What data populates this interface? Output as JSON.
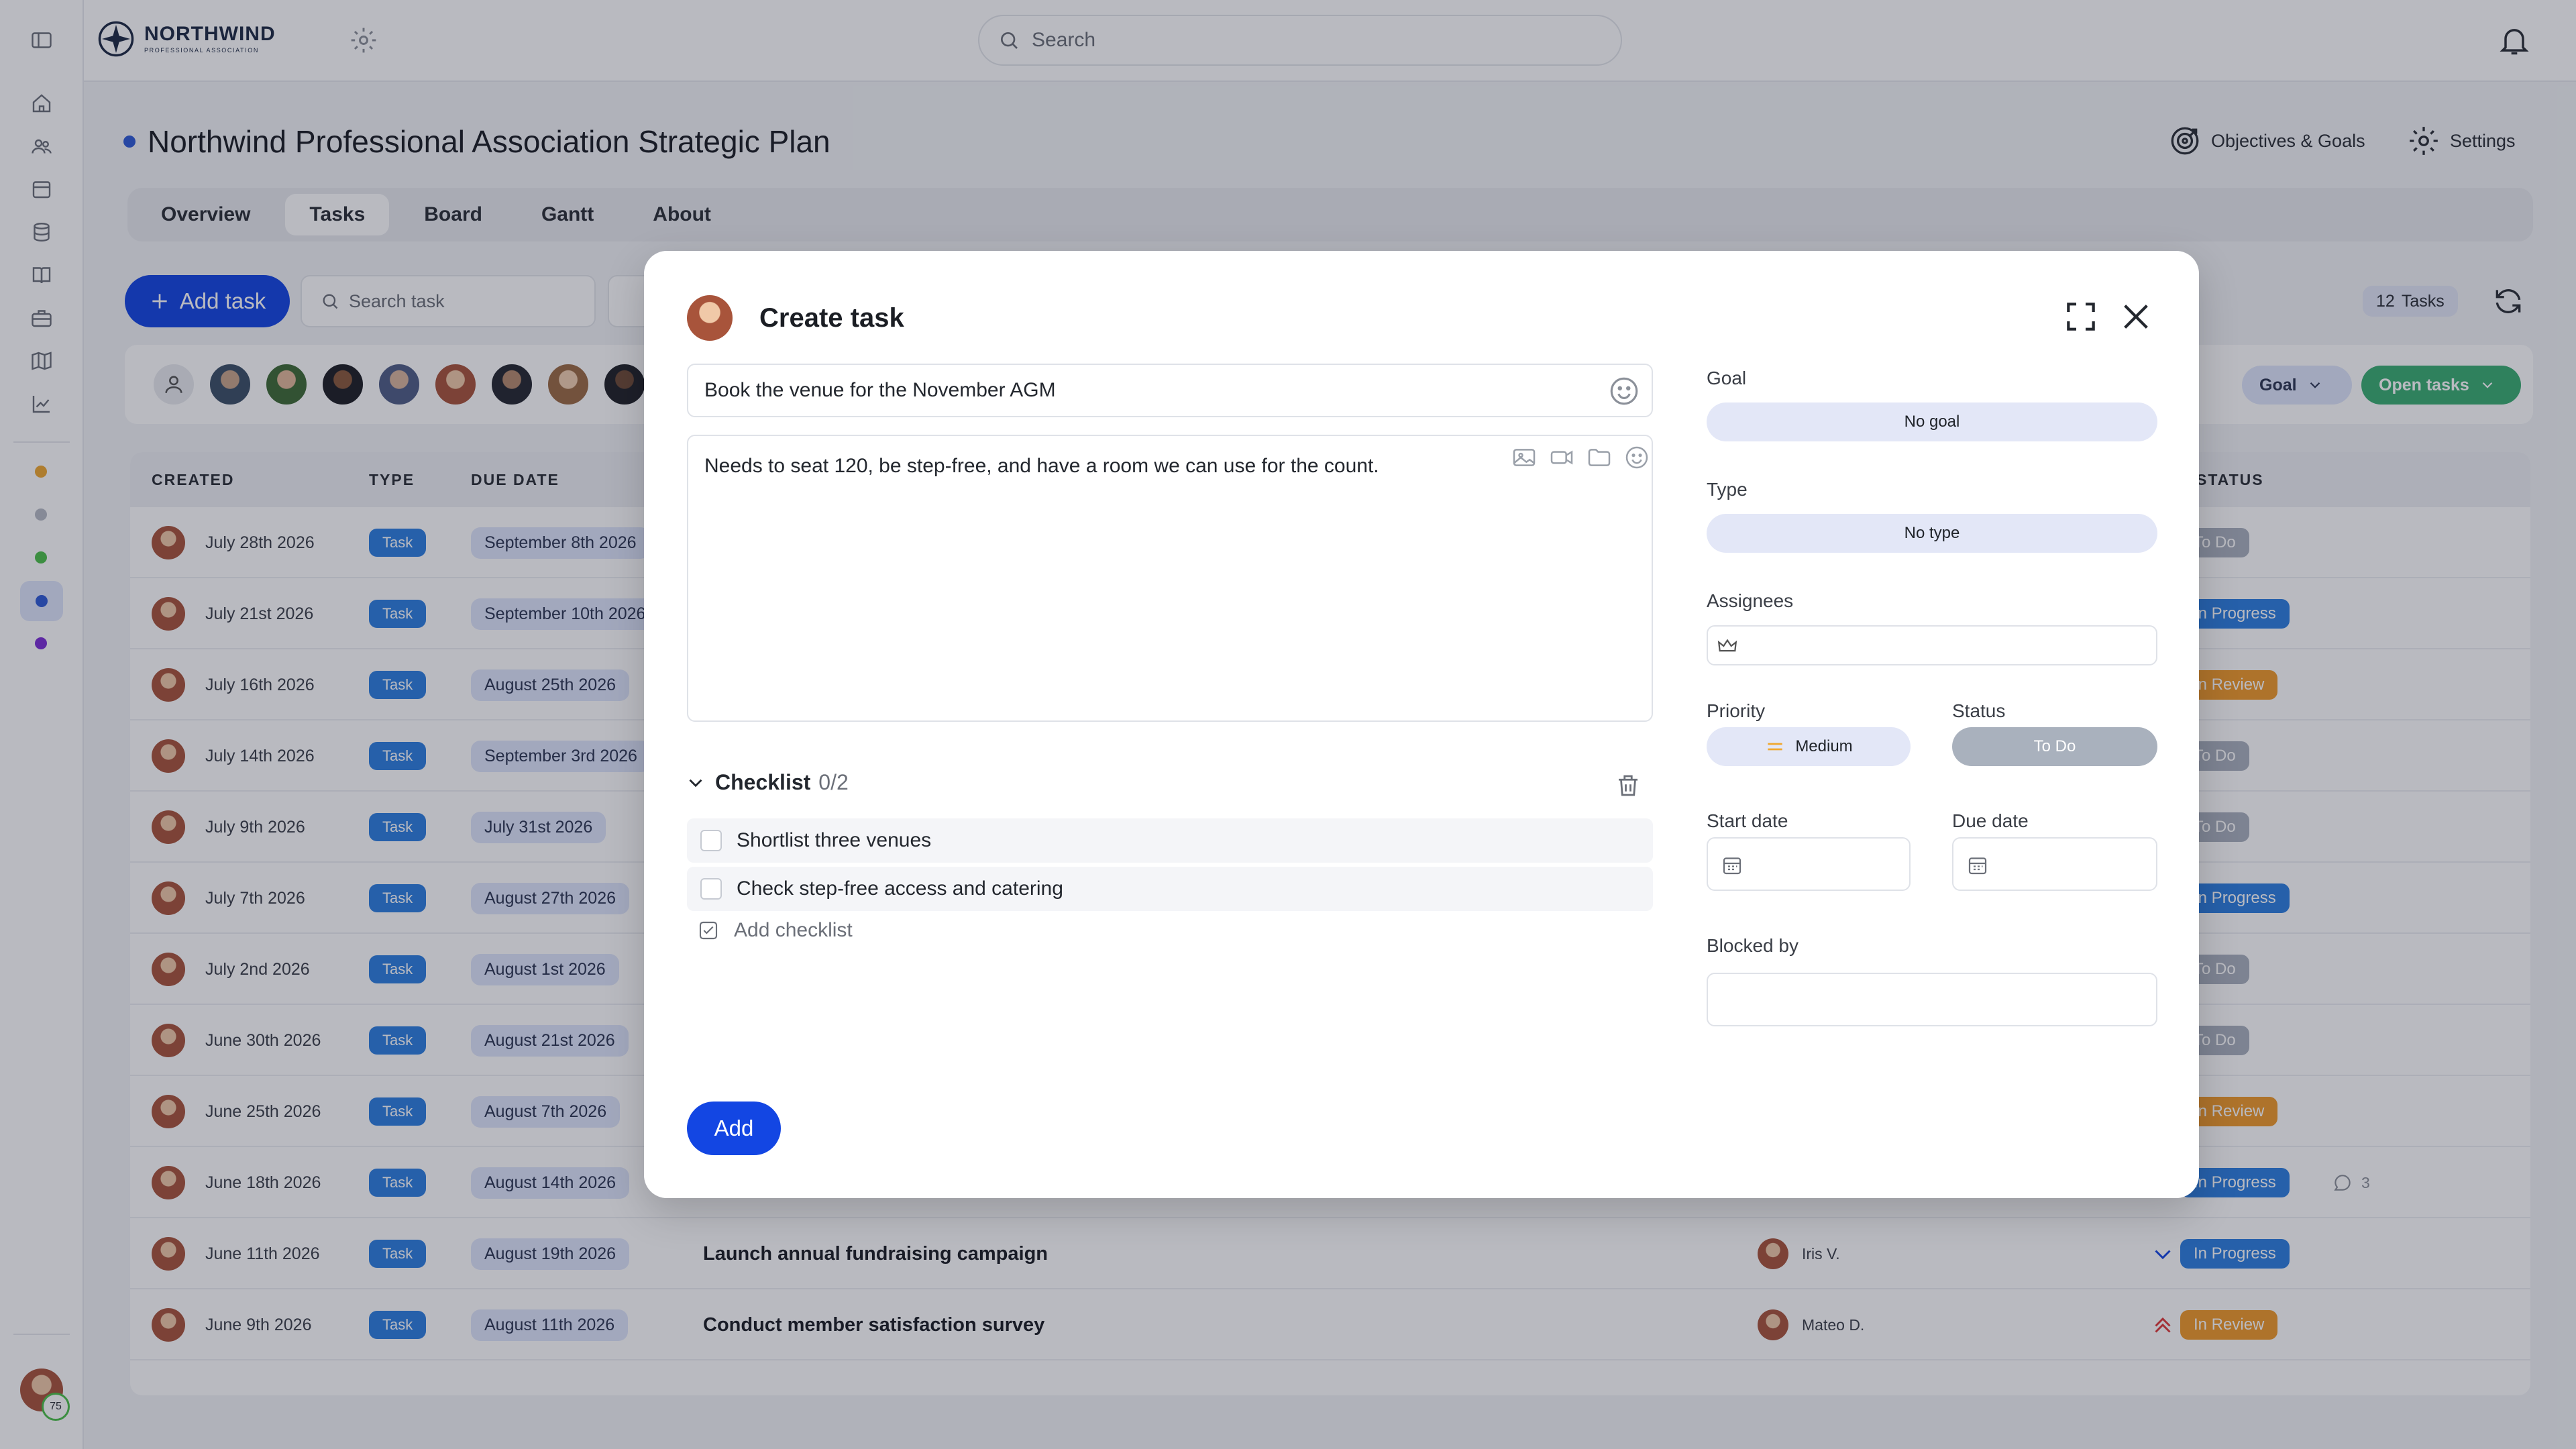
{
  "topbar": {
    "logo_name": "NORTHWIND",
    "logo_sub": "PROFESSIONAL ASSOCIATION",
    "search_placeholder": "Search"
  },
  "project": {
    "title": "Northwind Professional Association Strategic Plan",
    "objectives_label": "Objectives & Goals",
    "settings_label": "Settings",
    "accent_color": "#2f5bd6"
  },
  "tabs": [
    {
      "label": "Overview",
      "active": false
    },
    {
      "label": "Tasks",
      "active": true
    },
    {
      "label": "Board",
      "active": false
    },
    {
      "label": "Gantt",
      "active": false
    },
    {
      "label": "About",
      "active": false
    }
  ],
  "toolbar": {
    "add_task_label": "Add task",
    "search_task_placeholder": "Search task",
    "task_count": "12",
    "task_count_label": "Tasks"
  },
  "filters": {
    "goal_label": "Goal",
    "open_tasks_label": "Open tasks"
  },
  "table": {
    "headers": {
      "created": "CREATED",
      "type": "TYPE",
      "due": "DUE DATE",
      "status": "STATUS"
    },
    "rows": [
      {
        "created": "July 28th 2026",
        "type": "Task",
        "due": "September 8th 2026",
        "status": "To Do",
        "status_kind": "todo"
      },
      {
        "created": "July 21st 2026",
        "type": "Task",
        "due": "September 10th 2026",
        "status": "In Progress",
        "status_kind": "prog"
      },
      {
        "created": "July 16th 2026",
        "type": "Task",
        "due": "August 25th 2026",
        "status": "In Review",
        "status_kind": "rev"
      },
      {
        "created": "July 14th 2026",
        "type": "Task",
        "due": "September 3rd 2026",
        "status": "To Do",
        "status_kind": "todo"
      },
      {
        "created": "July 9th 2026",
        "type": "Task",
        "due": "July 31st 2026",
        "status": "To Do",
        "status_kind": "todo"
      },
      {
        "created": "July 7th 2026",
        "type": "Task",
        "due": "August 27th 2026",
        "status": "In Progress",
        "status_kind": "prog"
      },
      {
        "created": "July 2nd 2026",
        "type": "Task",
        "due": "August 1st 2026",
        "status": "To Do",
        "status_kind": "todo"
      },
      {
        "created": "June 30th 2026",
        "type": "Task",
        "due": "August 21st 2026",
        "status": "To Do",
        "status_kind": "todo"
      },
      {
        "created": "June 25th 2026",
        "type": "Task",
        "due": "August 7th 2026",
        "status": "In Review",
        "status_kind": "rev"
      },
      {
        "created": "June 18th 2026",
        "type": "Task",
        "due": "August 14th 2026",
        "status": "In Progress",
        "status_kind": "prog",
        "comments": "3"
      },
      {
        "created": "June 11th 2026",
        "type": "Task",
        "due": "August 19th 2026",
        "title": "Launch annual fundraising campaign",
        "assignee": "Iris V.",
        "priority": "Low",
        "status": "In Progress",
        "status_kind": "prog"
      },
      {
        "created": "June 9th 2026",
        "type": "Task",
        "due": "August 11th 2026",
        "title": "Conduct member satisfaction survey",
        "assignee": "Mateo D.",
        "priority": "Highest",
        "status": "In Review",
        "status_kind": "rev"
      }
    ]
  },
  "rail": {
    "badge": "75"
  },
  "modal": {
    "title": "Create task",
    "task_name": "Book the venue for the November AGM",
    "description": "Needs to seat 120, be step-free, and have a room we can use for the count.",
    "checklist_label": "Checklist",
    "checklist_count": "0/2",
    "checklist_items": [
      {
        "label": "Shortlist three venues"
      },
      {
        "label": "Check step-free access and catering"
      }
    ],
    "add_checklist_label": "Add checklist",
    "add_button": "Add",
    "goal_label": "Goal",
    "goal_value": "No goal",
    "type_label": "Type",
    "type_value": "No type",
    "assignees_label": "Assignees",
    "priority_label": "Priority",
    "priority_value": "Medium",
    "status_label": "Status",
    "status_value": "To Do",
    "start_date_label": "Start date",
    "due_date_label": "Due date",
    "blocked_by_label": "Blocked by"
  }
}
